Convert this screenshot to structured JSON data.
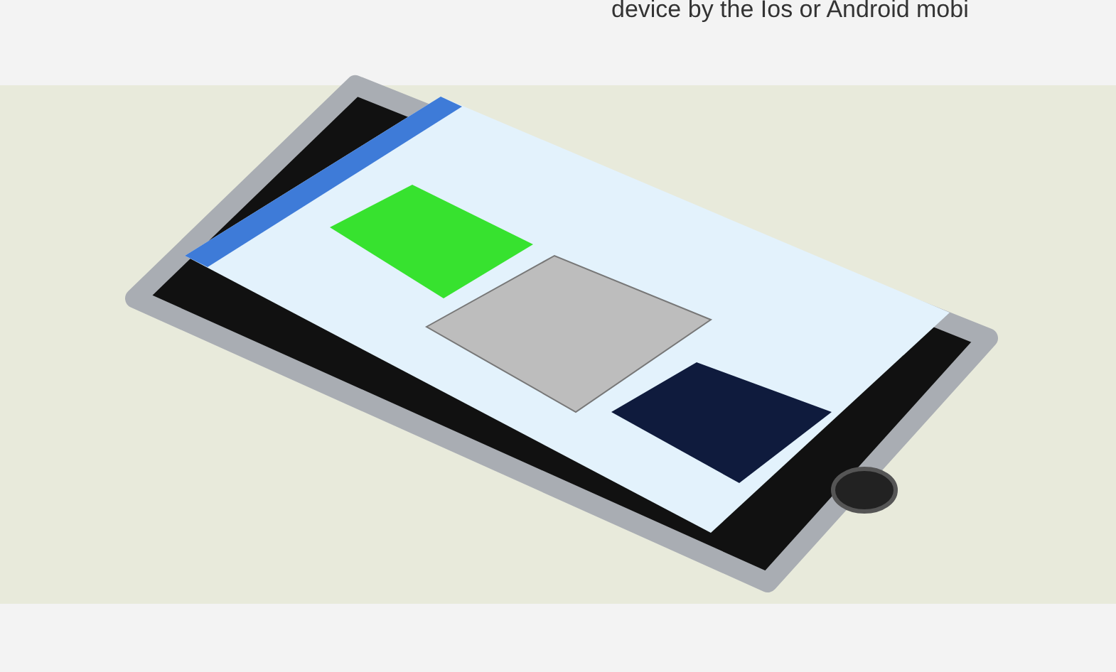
{
  "text_fragment": "device by the Ios or Android mobi"
}
